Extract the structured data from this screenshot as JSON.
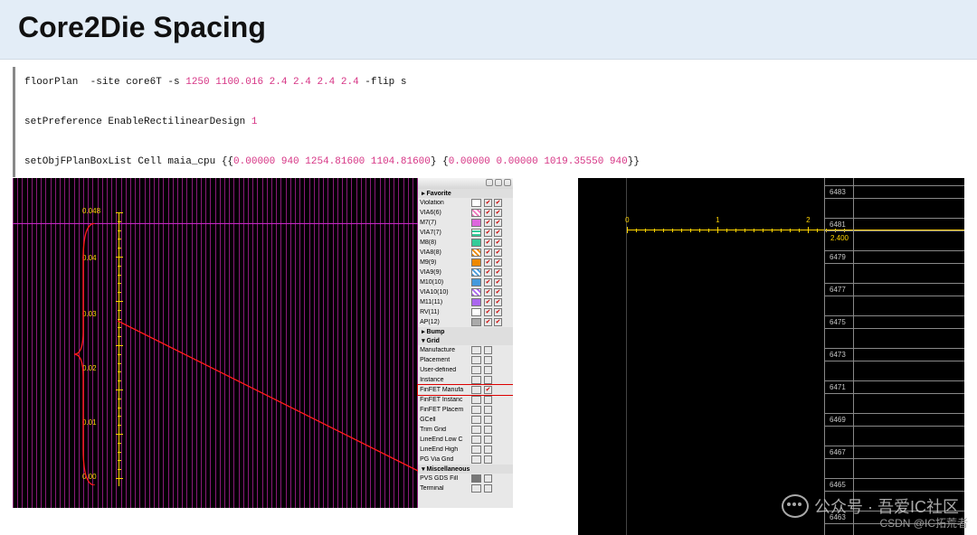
{
  "header": {
    "title": "Core2Die Spacing"
  },
  "code": {
    "line1_pre": "floorPlan  -site core6T -s ",
    "line1_num": "1250 1100.016 2.4 2.4 2.4 2.4",
    "line1_post": " -flip s",
    "line2_pre": "setPreference EnableRectilinearDesign ",
    "line2_num": "1",
    "line3_pre": "setObjFPlanBoxList Cell maia_cpu {{",
    "line3_num1": "0.00000 940 1254.81600 1104.81600",
    "line3_mid": "} {",
    "line3_num2": "0.00000 0.00000 1019.35550 940",
    "line3_post": "}}"
  },
  "left": {
    "ruler": {
      "t0": "0.048",
      "t1": "0.04",
      "t2": "0.03",
      "t3": "0.02",
      "t4": "0.01",
      "t5": "0.00"
    }
  },
  "layers": {
    "grp_fav": "Favorite",
    "violation": "Violation",
    "via6": "VIA6(6)",
    "m7": "M7(7)",
    "via7": "VIA7(7)",
    "m8": "M8(8)",
    "via8": "VIA8(8)",
    "m9": "M9(9)",
    "via9": "VIA9(9)",
    "m10": "M10(10)",
    "via10": "VIA10(10)",
    "m11": "M11(11)",
    "rv": "RV(11)",
    "ap": "AP(12)",
    "grp_bump": "Bump",
    "grp_floor": "Grid",
    "manufacture": "Manufacture",
    "placement": "Placement",
    "userdef": "User-defined",
    "instance": "Instance",
    "finfet_m": "FinFET Manufa",
    "finfet_i": "FinFET Instanc",
    "finfet_p": "FinFET Placem",
    "gcell": "GCell",
    "trim": "Trim Grid",
    "lel": "LineEnd Low C",
    "leh": "LineEnd High",
    "pgvia": "PG Via Grid",
    "grp_misc": "Miscellaneous",
    "pvs": "PVS GDS Fill",
    "terminal": "Terminal"
  },
  "right": {
    "ruler": {
      "l0": "0",
      "l1": "1",
      "l2": "2",
      "measure": "2.400"
    },
    "grid_labels": {
      "r0": "6483",
      "r1": "6481",
      "r2": "6479",
      "r3": "6477",
      "r4": "6475",
      "r5": "6473",
      "r6": "6471",
      "r7": "6469",
      "r8": "6467",
      "r9": "6465",
      "r10": "6463"
    }
  },
  "watermark": {
    "text": "公众号 · 吾爱IC社区",
    "csdn": "CSDN @IC拓荒者"
  }
}
